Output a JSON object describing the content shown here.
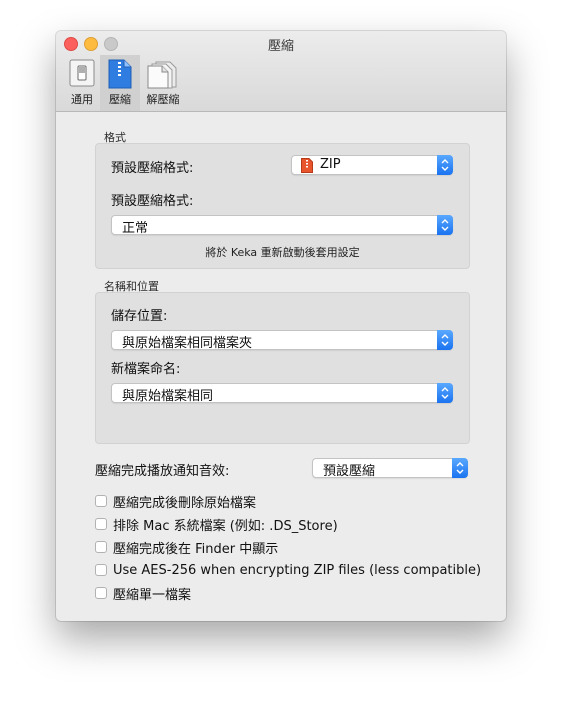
{
  "window": {
    "title": "壓縮"
  },
  "toolbar": {
    "tabs": [
      {
        "label": "通用"
      },
      {
        "label": "壓縮"
      },
      {
        "label": "解壓縮"
      }
    ]
  },
  "format_group": {
    "label": "格式",
    "default_format_label": "預設壓縮格式:",
    "default_format_value": "ZIP",
    "level_label": "預設壓縮格式:",
    "level_value": "正常",
    "note": "將於 Keka 重新啟動後套用設定"
  },
  "name_group": {
    "label": "名稱和位置",
    "save_location_label": "儲存位置:",
    "save_location_value": "與原始檔案相同檔案夾",
    "naming_label": "新檔案命名:",
    "naming_value": "與原始檔案相同"
  },
  "sound": {
    "label": "壓縮完成播放通知音效:",
    "value": "預設壓縮"
  },
  "options": [
    {
      "label": "壓縮完成後刪除原始檔案",
      "checked": false
    },
    {
      "label": "排除 Mac 系統檔案 (例如: .DS_Store)",
      "checked": false
    },
    {
      "label": "壓縮完成後在 Finder 中顯示",
      "checked": false
    },
    {
      "label": "Use AES-256 when encrypting ZIP files (less compatible)",
      "checked": false
    },
    {
      "label": "壓縮單一檔案",
      "checked": false
    }
  ],
  "colors": {
    "accent": "#1a73f0",
    "close": "#fc605c",
    "minimize": "#fdbc40"
  }
}
